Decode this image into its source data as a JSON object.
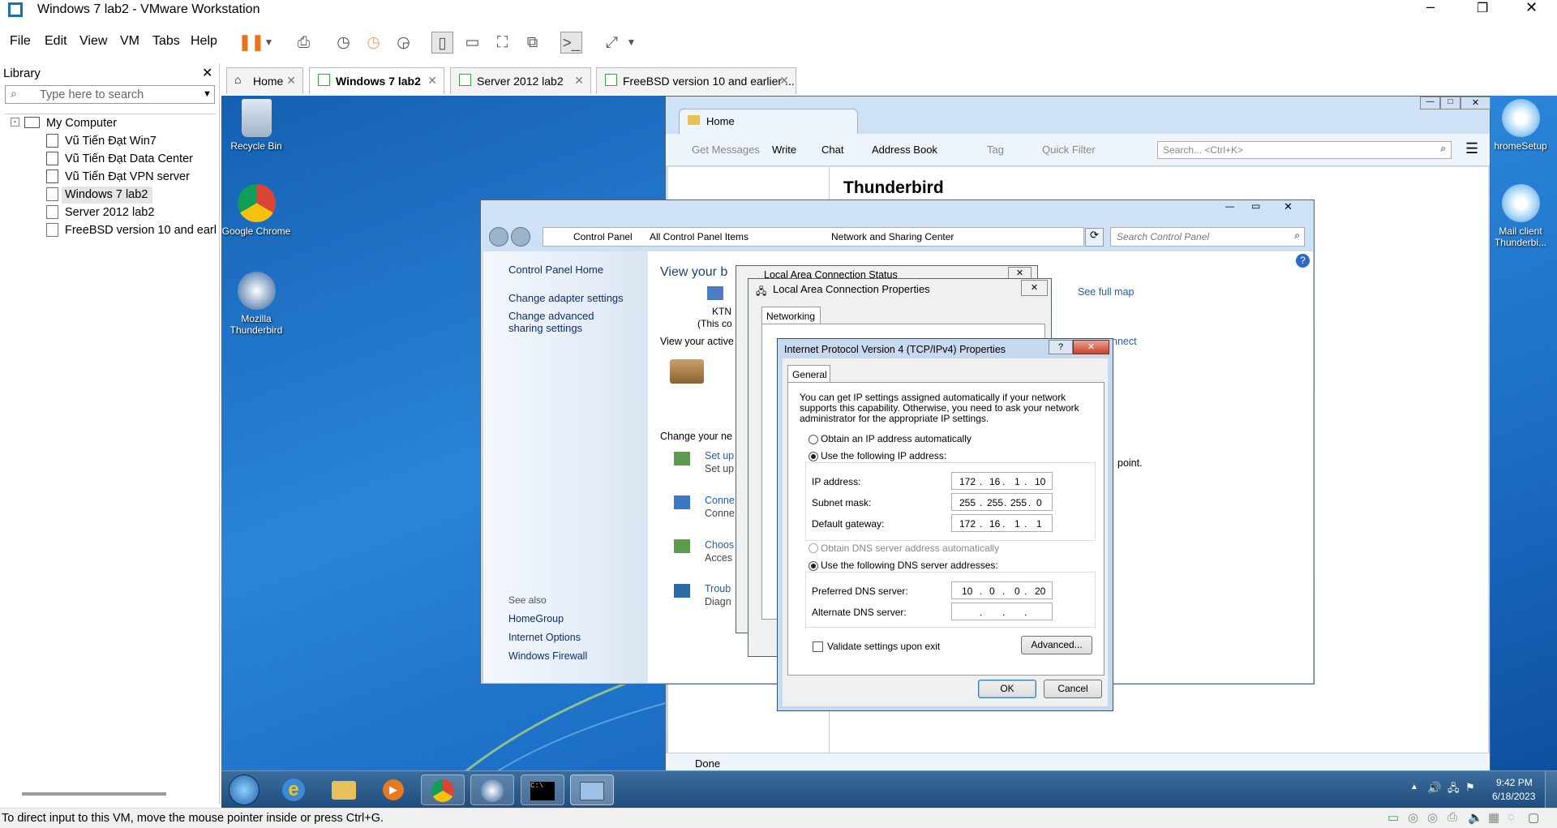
{
  "window": {
    "title": "Windows 7 lab2 - VMware Workstation"
  },
  "menu": [
    "File",
    "Edit",
    "View",
    "VM",
    "Tabs",
    "Help"
  ],
  "library": {
    "title": "Library",
    "search_placeholder": "Type here to search",
    "root": "My Computer",
    "items": [
      "Vũ Tiến Đạt Win7",
      "Vũ Tiến Đạt Data Center",
      "Vũ Tiến Đạt VPN server",
      "Windows 7 lab2",
      "Server 2012 lab2",
      "FreeBSD version 10 and earli"
    ]
  },
  "tabs": [
    {
      "label": "Home"
    },
    {
      "label": "Windows 7 lab2"
    },
    {
      "label": "Server 2012 lab2"
    },
    {
      "label": "FreeBSD version 10 and earlier ..."
    }
  ],
  "desktop": {
    "icons": [
      "Recycle Bin",
      "Google Chrome",
      "Mozilla Thunderbird"
    ],
    "right_icons": [
      "hromeSetup",
      "Mail client Thunderbi..."
    ]
  },
  "thunderbird": {
    "tab": "Home",
    "toolbar": [
      "Get Messages",
      "Write",
      "Chat",
      "Address Book",
      "Tag",
      "Quick Filter"
    ],
    "search_placeholder": "Search... <Ctrl+K>",
    "heading": "Thunderbird",
    "status": "Done"
  },
  "control_panel": {
    "breadcrumb": [
      "Control Panel",
      "All Control Panel Items",
      "Network and Sharing Center"
    ],
    "search_placeholder": "Search Control Panel",
    "sidebar": [
      "Control Panel Home",
      "Change adapter settings",
      "Change advanced sharing settings"
    ],
    "see_also_title": "See also",
    "see_also": [
      "HomeGroup",
      "Internet Options",
      "Windows Firewall"
    ],
    "main": {
      "view_your": "View your b",
      "see_full_map": "See full map",
      "ktn": "KTN",
      "this_co": "(This co",
      "view_active": "View your active",
      "change_net": "Change your ne",
      "connect": "nnect",
      "point": "point.",
      "tasks": [
        {
          "t": "Set up",
          "s": "Set up"
        },
        {
          "t": "Conne",
          "s": "Conne"
        },
        {
          "t": "Choos",
          "s": "Acces"
        },
        {
          "t": "Troub",
          "s": "Diagn"
        }
      ]
    }
  },
  "lac_status": {
    "title": "Local Area Connection Status"
  },
  "lac_props": {
    "title": "Local Area Connection Properties",
    "tab": "Networking"
  },
  "ipv4": {
    "title": "Internet Protocol Version 4 (TCP/IPv4) Properties",
    "tab": "General",
    "intro": "You can get IP settings assigned automatically if your network supports this capability. Otherwise, you need to ask your network administrator for the appropriate IP settings.",
    "obtain_ip": "Obtain an IP address automatically",
    "use_ip": "Use the following IP address:",
    "ip_label": "IP address:",
    "ip": [
      "172",
      "16",
      "1",
      "10"
    ],
    "mask_label": "Subnet mask:",
    "mask": [
      "255",
      "255",
      "255",
      "0"
    ],
    "gw_label": "Default gateway:",
    "gw": [
      "172",
      "16",
      "1",
      "1"
    ],
    "obtain_dns": "Obtain DNS server address automatically",
    "use_dns": "Use the following DNS server addresses:",
    "pdns_label": "Preferred DNS server:",
    "pdns": [
      "10",
      "0",
      "0",
      "20"
    ],
    "adns_label": "Alternate DNS server:",
    "adns": [
      "",
      "",
      "",
      ""
    ],
    "validate": "Validate settings upon exit",
    "advanced": "Advanced...",
    "ok": "OK",
    "cancel": "Cancel"
  },
  "clock": {
    "time": "9:42 PM",
    "date": "6/18/2023"
  },
  "status": "To direct input to this VM, move the mouse pointer inside or press Ctrl+G."
}
